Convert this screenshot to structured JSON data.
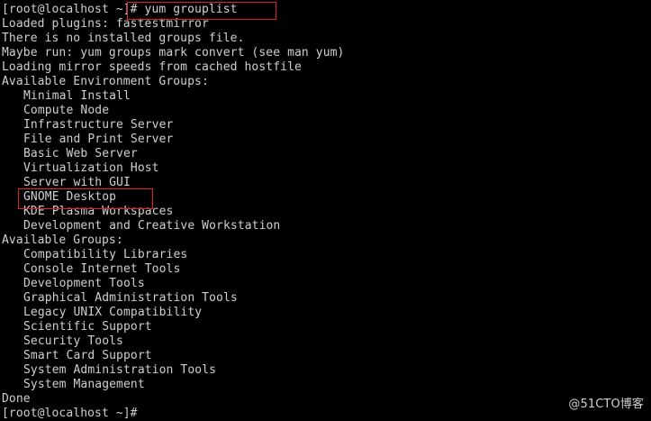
{
  "terminal": {
    "prompt_command": "[root@localhost ~]# yum grouplist",
    "messages": [
      "Loaded plugins: fastestmirror",
      "There is no installed groups file.",
      "Maybe run: yum groups mark convert (see man yum)",
      "Loading mirror speeds from cached hostfile"
    ],
    "env_header": "Available Environment Groups:",
    "env_groups": [
      "Minimal Install",
      "Compute Node",
      "Infrastructure Server",
      "File and Print Server",
      "Basic Web Server",
      "Virtualization Host",
      "Server with GUI",
      "GNOME Desktop",
      "KDE Plasma Workspaces",
      "Development and Creative Workstation"
    ],
    "groups_header": "Available Groups:",
    "groups": [
      "Compatibility Libraries",
      "Console Internet Tools",
      "Development Tools",
      "Graphical Administration Tools",
      "Legacy UNIX Compatibility",
      "Scientific Support",
      "Security Tools",
      "Smart Card Support",
      "System Administration Tools",
      "System Management"
    ],
    "done": "Done",
    "final_prompt": "[root@localhost ~]#",
    "highlight_color": "#e0232b"
  },
  "watermark": "@51CTO博客"
}
